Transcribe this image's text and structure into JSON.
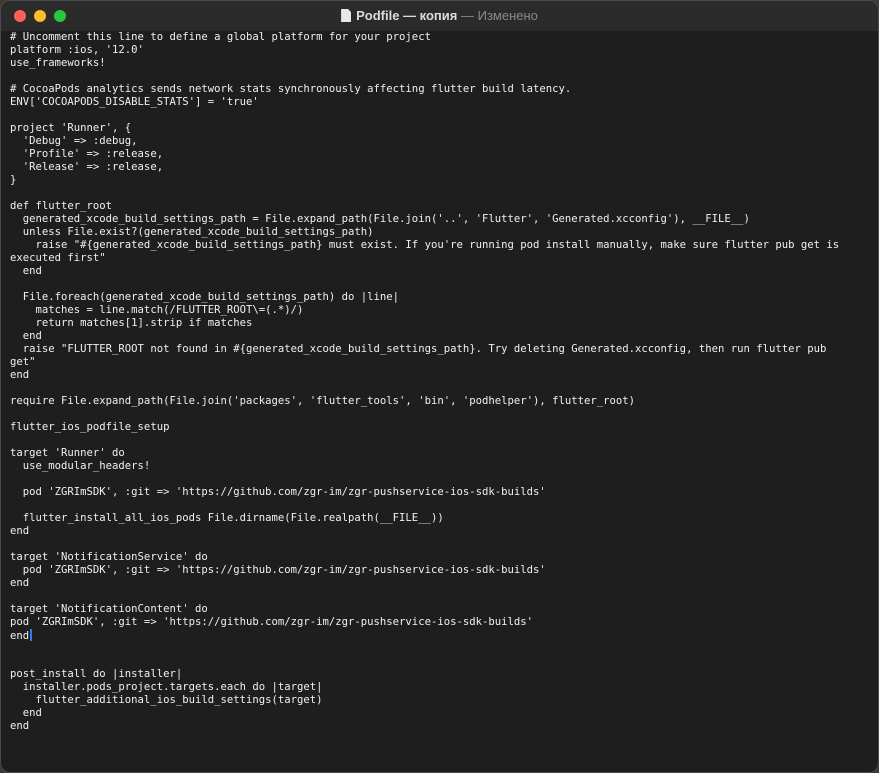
{
  "window": {
    "file_name": "Podfile — копия",
    "separator": "—",
    "status": "Изменено"
  },
  "editor": {
    "lines": [
      "# Uncomment this line to define a global platform for your project",
      "platform :ios, '12.0'",
      "use_frameworks!",
      "",
      "# CocoaPods analytics sends network stats synchronously affecting flutter build latency.",
      "ENV['COCOAPODS_DISABLE_STATS'] = 'true'",
      "",
      "project 'Runner', {",
      "  'Debug' => :debug,",
      "  'Profile' => :release,",
      "  'Release' => :release,",
      "}",
      "",
      "def flutter_root",
      "  generated_xcode_build_settings_path = File.expand_path(File.join('..', 'Flutter', 'Generated.xcconfig'), __FILE__)",
      "  unless File.exist?(generated_xcode_build_settings_path)",
      "    raise \"#{generated_xcode_build_settings_path} must exist. If you're running pod install manually, make sure flutter pub get is",
      "executed first\"",
      "  end",
      "",
      "  File.foreach(generated_xcode_build_settings_path) do |line|",
      "    matches = line.match(/FLUTTER_ROOT\\=(.*)/)",
      "    return matches[1].strip if matches",
      "  end",
      "  raise \"FLUTTER_ROOT not found in #{generated_xcode_build_settings_path}. Try deleting Generated.xcconfig, then run flutter pub",
      "get\"",
      "end",
      "",
      "require File.expand_path(File.join('packages', 'flutter_tools', 'bin', 'podhelper'), flutter_root)",
      "",
      "flutter_ios_podfile_setup",
      "",
      "target 'Runner' do",
      "  use_modular_headers!",
      "",
      "  pod 'ZGRImSDK', :git => 'https://github.com/zgr-im/zgr-pushservice-ios-sdk-builds'",
      "",
      "  flutter_install_all_ios_pods File.dirname(File.realpath(__FILE__))",
      "end",
      "",
      "target 'NotificationService' do",
      "  pod 'ZGRImSDK', :git => 'https://github.com/zgr-im/zgr-pushservice-ios-sdk-builds'",
      "end",
      "",
      "target 'NotificationContent' do",
      "pod 'ZGRImSDK', :git => 'https://github.com/zgr-im/zgr-pushservice-ios-sdk-builds'",
      "end",
      "",
      "",
      "post_install do |installer|",
      "  installer.pods_project.targets.each do |target|",
      "    flutter_additional_ios_build_settings(target)",
      "  end",
      "end"
    ],
    "caret_line": 46
  }
}
